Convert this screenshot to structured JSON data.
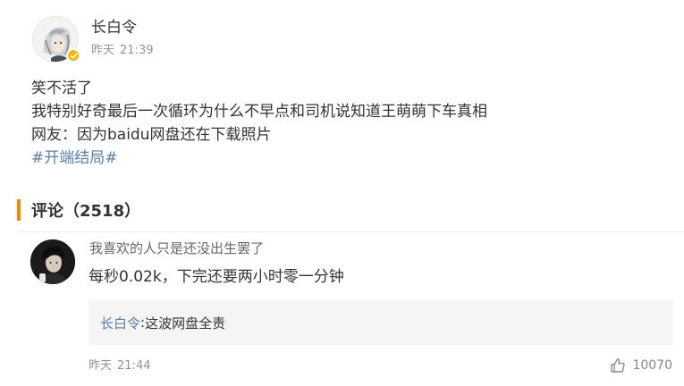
{
  "post": {
    "author": "长白令",
    "date": "昨天",
    "time": "21:39",
    "lines": [
      "笑不活了",
      "我特别好奇最后一次循环为什么不早点和司机说知道王萌萌下车真相",
      "网友：因为baidu网盘还在下载照片"
    ],
    "hashtag": "#开端结局#"
  },
  "comments": {
    "heading": "评论（2518）",
    "accent_color": "#ff8200",
    "items": [
      {
        "author": "我喜欢的人只是还没出生罢了",
        "text": "每秒0.02k，下完还要两小时零一分钟",
        "reply": {
          "user": "长白令",
          "separator": ":",
          "text": "这波网盘全责"
        },
        "date": "昨天",
        "time": "21:44",
        "likes": "10070"
      }
    ]
  },
  "colors": {
    "link": "#5b7fa8",
    "verified": "#f5b800",
    "muted": "#939393"
  },
  "icons": {
    "verified": "verified-badge-icon",
    "like": "thumbs-up-icon"
  }
}
